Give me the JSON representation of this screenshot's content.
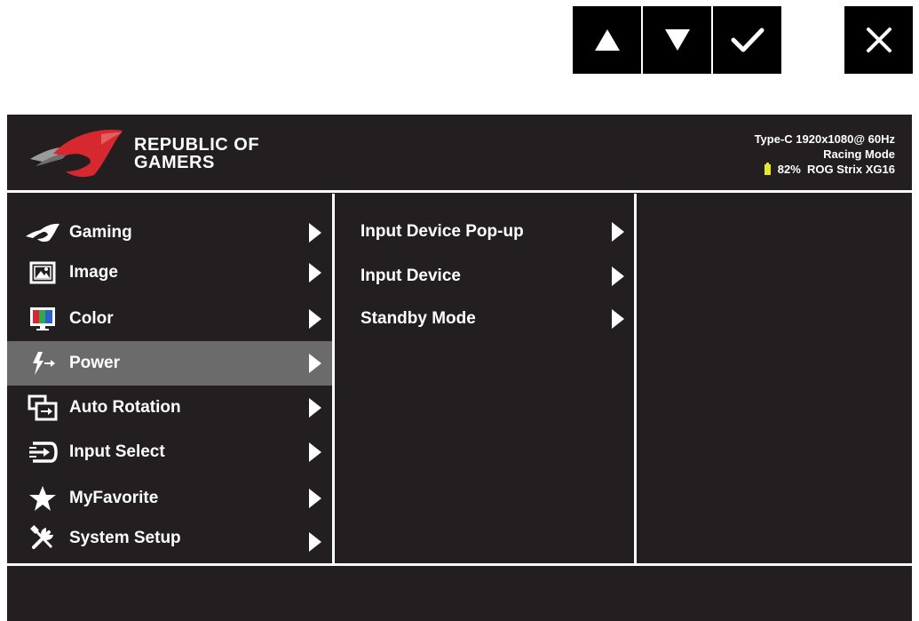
{
  "nav_keys": [
    {
      "name": "up",
      "icon": "up-arrow-icon"
    },
    {
      "name": "down",
      "icon": "down-arrow-icon"
    },
    {
      "name": "ok",
      "icon": "checkmark-icon"
    },
    {
      "name": "close",
      "icon": "close-icon"
    }
  ],
  "header": {
    "brand_line1": "REPUBLIC OF",
    "brand_line2": "GAMERS",
    "status_line1": "Type-C 1920x1080@  60Hz",
    "status_line2": "Racing Mode",
    "battery_percent": "82%",
    "model": "ROG Strix XG16"
  },
  "menu": {
    "items": [
      {
        "label": "Gaming",
        "icon": "rog-eye-icon"
      },
      {
        "label": "Image",
        "icon": "image-icon"
      },
      {
        "label": "Color",
        "icon": "color-icon"
      },
      {
        "label": "Power",
        "icon": "power-icon",
        "selected": true
      },
      {
        "label": "Auto Rotation",
        "icon": "auto-rotation-icon"
      },
      {
        "label": "Input Select",
        "icon": "input-select-icon"
      },
      {
        "label": "MyFavorite",
        "icon": "star-icon"
      },
      {
        "label": "System Setup",
        "icon": "system-setup-icon"
      }
    ]
  },
  "submenu": {
    "items": [
      {
        "label": "Input Device Pop-up"
      },
      {
        "label": "Input Device"
      },
      {
        "label": "Standby Mode"
      }
    ]
  },
  "colors": {
    "panel_bg": "#231f20",
    "selected_bg": "#6c6b6b",
    "accent_red": "#d7282f",
    "battery": "#e6e62b"
  }
}
